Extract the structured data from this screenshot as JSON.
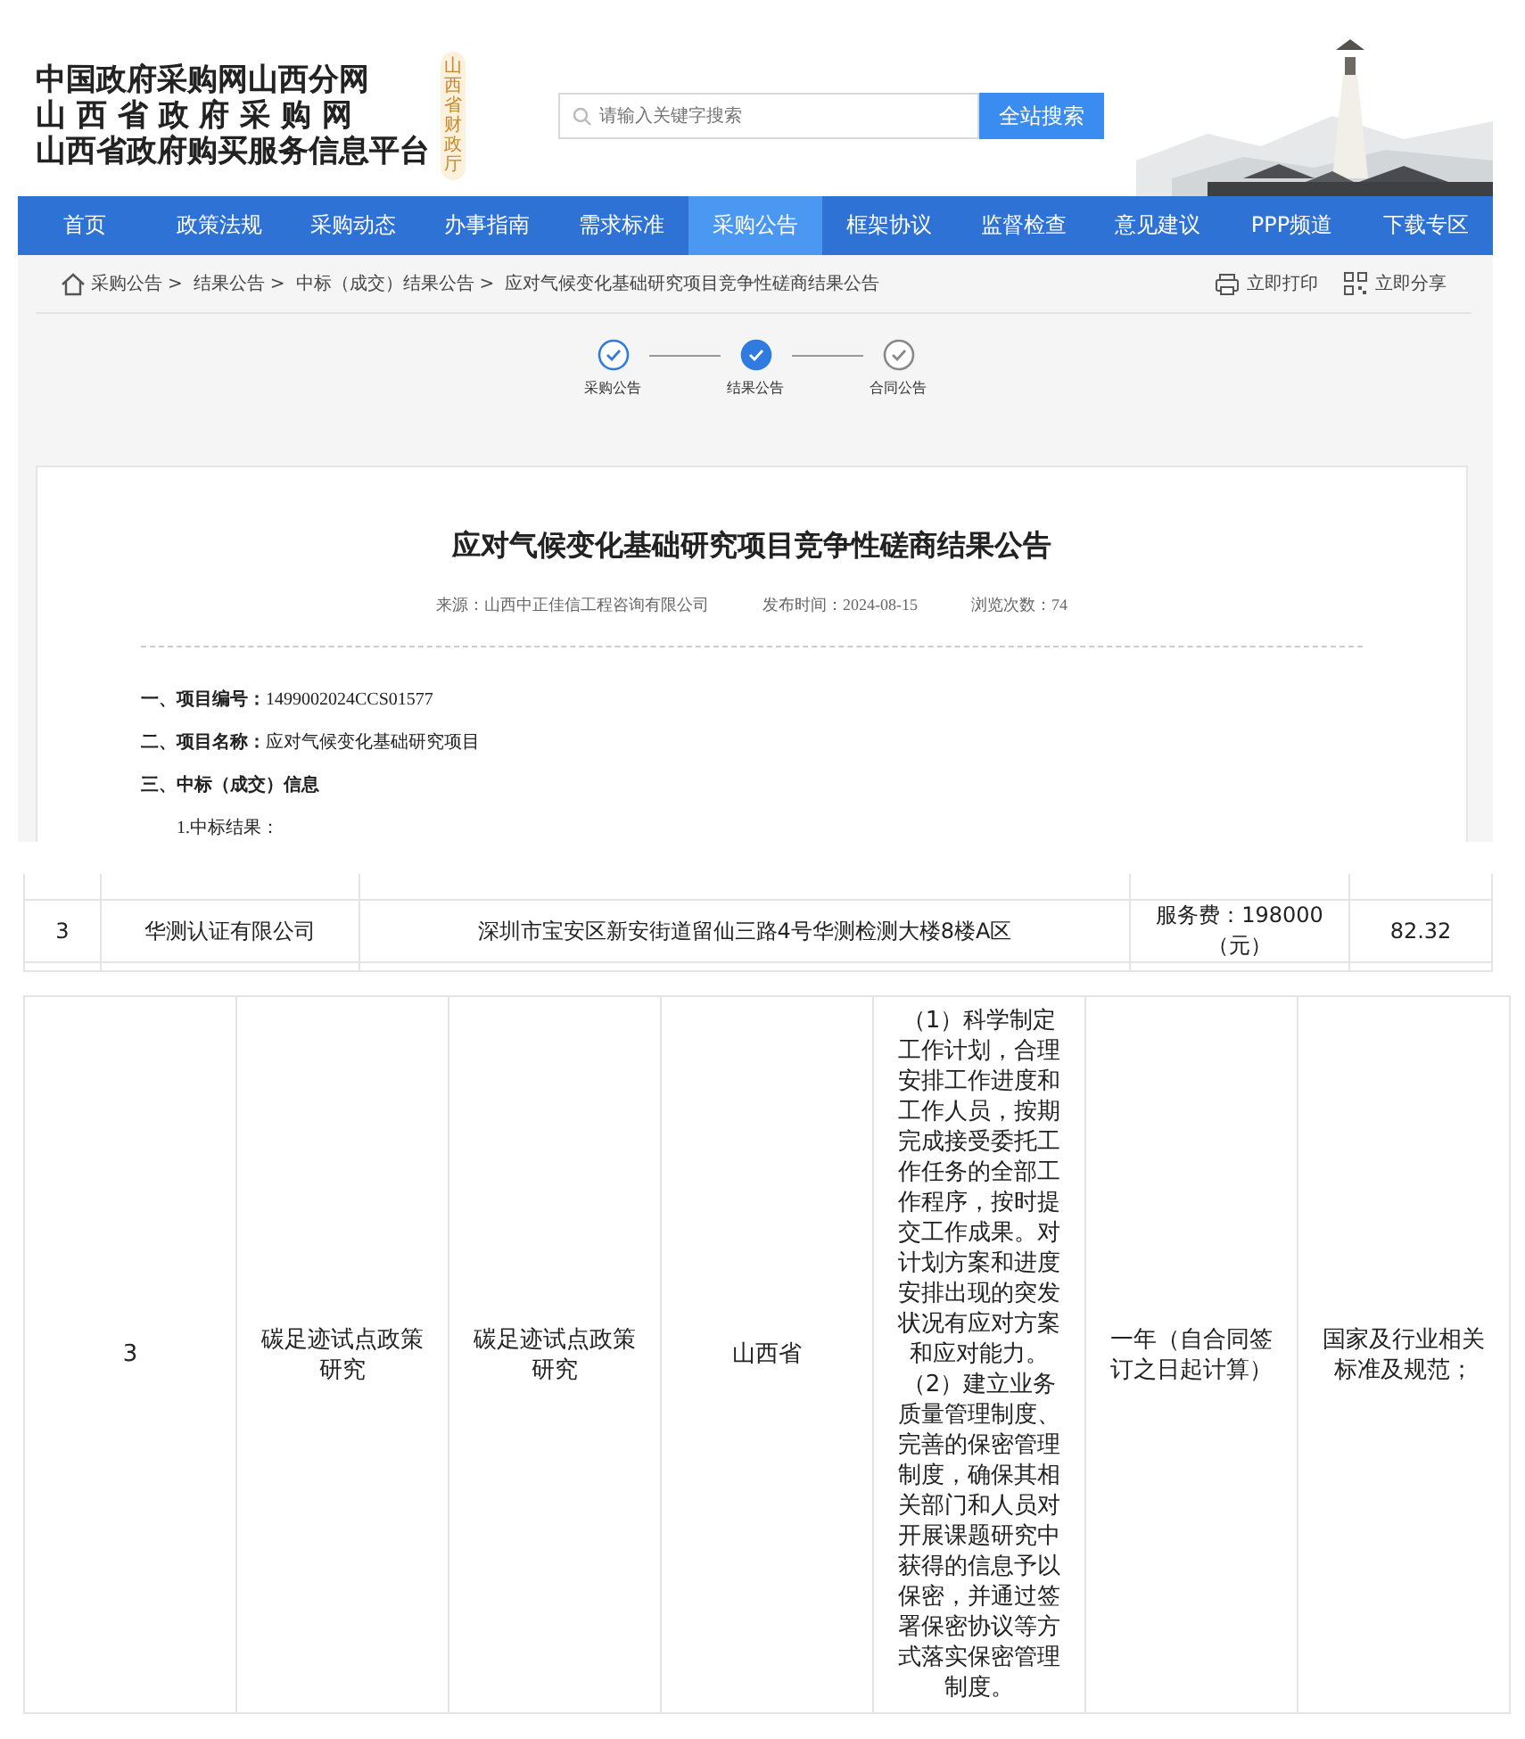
{
  "header": {
    "logo_lines": [
      "中国政府采购网山西分网",
      "山 西 省 政 府 采 购 网",
      "山西省政府购买服务信息平台"
    ],
    "badge": "山西省财政厅",
    "search": {
      "placeholder": "请输入关键字搜索",
      "button": "全站搜索"
    }
  },
  "nav": [
    {
      "label": "首页",
      "selected": false
    },
    {
      "label": "政策法规",
      "selected": false
    },
    {
      "label": "采购动态",
      "selected": false
    },
    {
      "label": "办事指南",
      "selected": false
    },
    {
      "label": "需求标准",
      "selected": false
    },
    {
      "label": "采购公告",
      "selected": true
    },
    {
      "label": "框架协议",
      "selected": false
    },
    {
      "label": "监督检查",
      "selected": false
    },
    {
      "label": "意见建议",
      "selected": false
    },
    {
      "label": "PPP频道",
      "selected": false
    },
    {
      "label": "下载专区",
      "selected": false
    }
  ],
  "breadcrumb": {
    "separator": ">",
    "items": [
      "采购公告",
      "结果公告",
      "中标（成交）结果公告",
      "应对气候变化基础研究项目竞争性磋商结果公告"
    ]
  },
  "actions": [
    {
      "kind": "print",
      "label": "立即打印"
    },
    {
      "kind": "share",
      "label": "立即分享"
    }
  ],
  "steps": [
    {
      "label": "采购公告",
      "completed": true,
      "active": false
    },
    {
      "label": "结果公告",
      "completed": true,
      "active": true
    },
    {
      "label": "合同公告",
      "completed": false,
      "active": false
    }
  ],
  "article": {
    "title": "应对气候变化基础研究项目竞争性磋商结果公告",
    "meta": [
      {
        "label": "来源：",
        "value": "山西中正佳信工程咨询有限公司"
      },
      {
        "label": "发布时间：",
        "value": "2024-08-15"
      },
      {
        "label": "浏览次数：",
        "value": "74"
      }
    ],
    "items": [
      {
        "label": "一、项目编号：",
        "value": "1499002024CCS01577"
      },
      {
        "label": "二、项目名称：",
        "value": "应对气候变化基础研究项目"
      },
      {
        "label": "三、中标（成交）信息"
      }
    ],
    "sub": "1.中标结果："
  },
  "table_1": {
    "rows": [
      [
        "3",
        "华测认证有限公司",
        "深圳市宝安区新安街道留仙三路4号华测检测大楼8楼A区",
        "服务费：198000（元）",
        "82.32"
      ]
    ]
  },
  "table_2": {
    "rows": [
      [
        [
          "3"
        ],
        [
          "碳足迹试点政策研究"
        ],
        [
          "碳足迹试点政策研究"
        ],
        [
          "山西省"
        ],
        [
          "（1）科学制定工作计划，合理安排工作进度和工作人员，按期完成接受委托工作任务的全部工作程序，按时提交工作成果。对计划方案和进度安排出现的突发状况有应对方案和应对能力。",
          "（2）建立业务质量管理制度、完善的保密管理制度，确保其相关部门和人员对开展课题研究中获得的信息予以保密，并通过签署保密协议等方式落实保密管理制度。"
        ],
        [
          "一年（自合同签订之日起计算）"
        ],
        [
          "国家及行业相关标准及规范；"
        ]
      ]
    ]
  }
}
